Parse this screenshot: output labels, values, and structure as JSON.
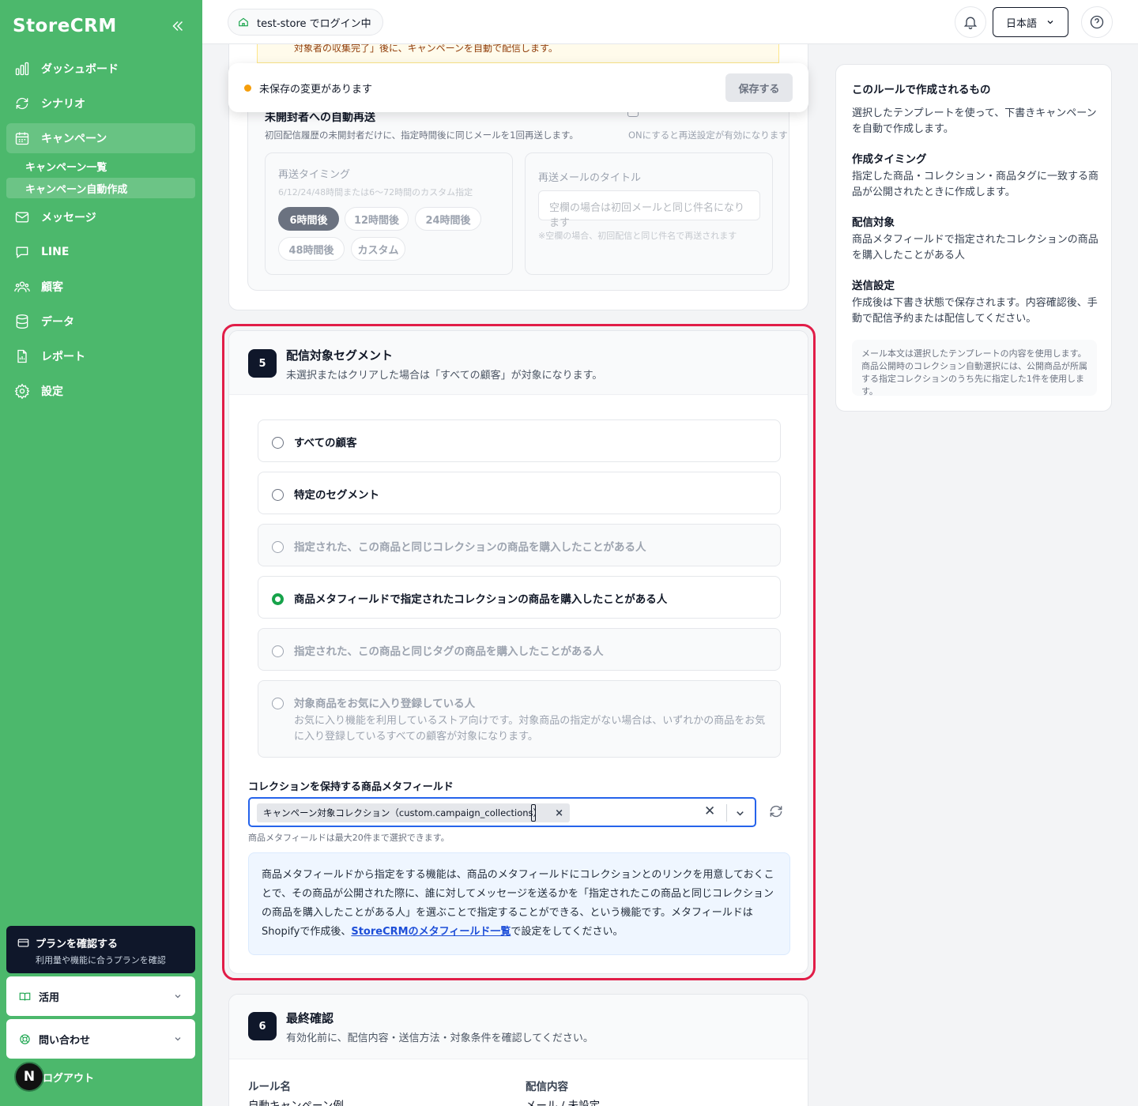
{
  "sidebar": {
    "brand": "StoreCRM",
    "nav": [
      {
        "label": "ダッシュボード",
        "icon": "bar-chart-icon"
      },
      {
        "label": "シナリオ",
        "icon": "refresh-icon"
      },
      {
        "label": "キャンペーン",
        "icon": "calendar-icon",
        "active": true
      },
      {
        "label": "メッセージ",
        "icon": "mail-icon"
      },
      {
        "label": "LINE",
        "icon": "chat-icon"
      },
      {
        "label": "顧客",
        "icon": "users-icon"
      },
      {
        "label": "データ",
        "icon": "database-icon"
      },
      {
        "label": "レポート",
        "icon": "report-icon"
      },
      {
        "label": "設定",
        "icon": "gear-icon"
      }
    ],
    "sub_items": [
      {
        "label": "キャンペーン一覧"
      },
      {
        "label": "キャンペーン自動作成",
        "active": true
      }
    ],
    "plan": {
      "title": "プランを確認する",
      "subtitle": "利用量や機能に合うプランを確認"
    },
    "usage": "活用",
    "contact": "問い合わせ",
    "avatar": "N",
    "logout": "ログアウト"
  },
  "topbar": {
    "store": "test-store でログイン中",
    "language": "日本語"
  },
  "card4": {
    "warning_text": "対象者の収集完了」後に、キャンペーンを自動で配信します。",
    "unsaved_text": "未保存の変更があります",
    "save_label": "保存する",
    "resend_title": "未開封者への自動再送",
    "resend_desc": "初回配信履歴の未開封者だけに、指定時間後に同じメールを1回再送します。",
    "resend_toggle_note": "ONにすると再送設定が有効になります",
    "timing_title": "再送タイミング",
    "timing_desc": "6/12/24/48時間または6〜72時間のカスタム指定",
    "chips": [
      "6時間後",
      "12時間後",
      "24時間後",
      "48時間後",
      "カスタム"
    ],
    "selected_chip": "6時間後",
    "mail_title_label": "再送メールのタイトル",
    "mail_title_placeholder": "空欄の場合は初回メールと同じ件名になります",
    "mail_title_hint": "※空欄の場合、初回配信と同じ件名で再送されます"
  },
  "section5": {
    "number": "5",
    "title": "配信対象セグメント",
    "desc": "未選択またはクリアした場合は「すべての顧客」が対象になります。",
    "options": [
      {
        "label": "すべての顧客",
        "disabled": false,
        "selected": false
      },
      {
        "label": "特定のセグメント",
        "disabled": false,
        "selected": false
      },
      {
        "label": "指定された、この商品と同じコレクションの商品を購入したことがある人",
        "disabled": true,
        "selected": false
      },
      {
        "label": "商品メタフィールドで指定されたコレクションの商品を購入したことがある人",
        "disabled": false,
        "selected": true
      },
      {
        "label": "指定された、この商品と同じタグの商品を購入したことがある人",
        "disabled": true,
        "selected": false
      },
      {
        "label": "対象商品をお気に入り登録している人",
        "sub": "お気に入り機能を利用しているストア向けです。対象商品の指定がない場合は、いずれかの商品をお気に入り登録しているすべての顧客が対象になります。",
        "disabled": true,
        "selected": false
      }
    ],
    "field_label": "コレクションを保持する商品メタフィールド",
    "selected_tag": "キャンペーン対象コレクション（custom.campaign_collections）",
    "field_hint": "商品メタフィールドは最大20件まで選択できます。",
    "info_text": "商品メタフィールドから指定をする機能は、商品のメタフィールドにコレクションとのリンクを用意しておくことで、その商品が公開された際に、誰に対してメッセージを送るかを「指定されたこの商品と同じコレクションの商品を購入したことがある人」を選ぶことで指定することができる、という機能です。メタフィールドはShopifyで作成後、",
    "info_link": "StoreCRMのメタフィールド一覧",
    "info_tail": "で設定をしてください。"
  },
  "section6": {
    "number": "6",
    "title": "最終確認",
    "desc": "有効化前に、配信内容・送信方法・対象条件を確認してください。",
    "rule_label": "ルール名",
    "rule_value": "自動キャンペーン例",
    "content_label": "配信内容",
    "content_value": "メール / 未設定"
  },
  "right_panel": {
    "title": "このルールで作成されるもの",
    "intro": "選択したテンプレートを使って、下書きキャンペーンを自動で作成します。",
    "timing_h": "作成タイミング",
    "timing_t": "指定した商品・コレクション・商品タグに一致する商品が公開されたときに作成します。",
    "target_h": "配信対象",
    "target_t": "商品メタフィールドで指定されたコレクションの商品を購入したことがある人",
    "send_h": "送信設定",
    "send_t": "作成後は下書き状態で保存されます。内容確認後、手動で配信予約または配信してください。",
    "note": "メール本文は選択したテンプレートの内容を使用します。商品公開時のコレクション自動選択には、公開商品が所属する指定コレクションのうち先に指定した1件を使用します。"
  },
  "colors": {
    "sidebar": "#4cb86c",
    "highlight": "#e11d48",
    "selected_radio": "#16a34a",
    "focus": "#2563eb"
  }
}
